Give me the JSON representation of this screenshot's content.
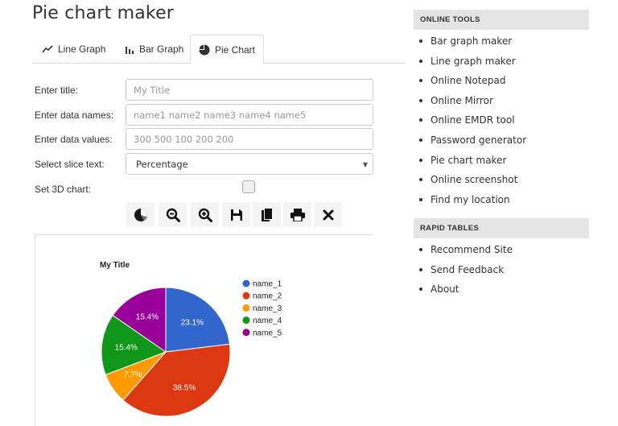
{
  "page": {
    "title": "Pie chart maker"
  },
  "tabs": [
    {
      "label": "Line Graph",
      "icon": "line-chart-icon"
    },
    {
      "label": "Bar Graph",
      "icon": "bar-chart-icon"
    },
    {
      "label": "Pie Chart",
      "icon": "pie-chart-icon",
      "active": true
    }
  ],
  "form": {
    "title_label": "Enter title:",
    "title_placeholder": "My Title",
    "names_label": "Enter data names:",
    "names_placeholder": "name1 name2 name3 name4 name5",
    "values_label": "Enter data values:",
    "values_placeholder": "300 500 100 200 200",
    "slice_label": "Select slice text:",
    "slice_value": "Percentage",
    "threed_label": "Set 3D chart:",
    "threed_checked": false
  },
  "toolbar": [
    {
      "name": "draw-chart-button",
      "icon": "pie-draw-icon"
    },
    {
      "name": "zoom-out-button",
      "icon": "zoom-out-icon"
    },
    {
      "name": "zoom-in-button",
      "icon": "zoom-in-icon"
    },
    {
      "name": "save-button",
      "icon": "save-icon"
    },
    {
      "name": "copy-button",
      "icon": "copy-icon"
    },
    {
      "name": "print-button",
      "icon": "print-icon"
    },
    {
      "name": "clear-button",
      "icon": "close-icon"
    }
  ],
  "chart_data": {
    "type": "pie",
    "title": "My Title",
    "categories": [
      "name_1",
      "name_2",
      "name_3",
      "name_4",
      "name_5"
    ],
    "values": [
      300,
      500,
      100,
      200,
      200
    ],
    "labels": [
      "23.1%",
      "38.5%",
      "7.7%",
      "15.4%",
      "15.4%"
    ],
    "colors": [
      "#3366cc",
      "#dc3912",
      "#ff9900",
      "#109618",
      "#990099"
    ],
    "legend": "right"
  },
  "sidebar": {
    "online_tools_heading": "ONLINE TOOLS",
    "online_tools": [
      "Bar graph maker",
      "Line graph maker",
      "Online Notepad",
      "Online Mirror",
      "Online EMDR tool",
      "Password generator",
      "Pie chart maker",
      "Online screenshot",
      "Find my location"
    ],
    "rapid_tables_heading": "RAPID TABLES",
    "rapid_tables": [
      "Recommend Site",
      "Send Feedback",
      "About"
    ]
  }
}
